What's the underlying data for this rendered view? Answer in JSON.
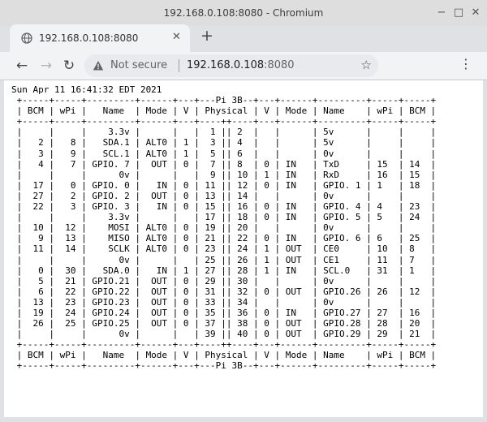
{
  "window": {
    "title": "192.168.0.108:8080 - Chromium",
    "controls": {
      "minimize": "−",
      "maximize": "□",
      "close": "✕"
    }
  },
  "tab": {
    "title": "192.168.0.108:8080",
    "favicon": "globe-icon",
    "close": "✕"
  },
  "new_tab": "+",
  "toolbar": {
    "back": "←",
    "forward": "→",
    "reload": "↻",
    "security_icon": "warning-triangle-icon",
    "not_secure": "Not secure",
    "url_host": "192.168.0.108",
    "url_port": ":8080",
    "bookmark": "☆",
    "menu": "⋮"
  },
  "page": {
    "lines": [
      "Sun Apr 11 16:41:32 EDT 2021",
      " +-----+-----+---------+------+---+---Pi 3B--+---+------+---------+-----+-----+",
      " | BCM | wPi |   Name  | Mode | V | Physical | V | Mode | Name    | wPi | BCM |",
      " +-----+-----+---------+------+---+----++----+---+------+---------+-----+-----+",
      " |     |     |    3.3v |      |   |  1 || 2  |   |      | 5v      |     |     |",
      " |   2 |   8 |   SDA.1 | ALT0 | 1 |  3 || 4  |   |      | 5v      |     |     |",
      " |   3 |   9 |   SCL.1 | ALT0 | 1 |  5 || 6  |   |      | 0v      |     |     |",
      " |   4 |   7 | GPIO. 7 |  OUT | 0 |  7 || 8  | 0 | IN   | TxD     | 15  | 14  |",
      " |     |     |      0v |      |   |  9 || 10 | 1 | IN   | RxD     | 16  | 15  |",
      " |  17 |   0 | GPIO. 0 |   IN | 0 | 11 || 12 | 0 | IN   | GPIO. 1 | 1   | 18  |",
      " |  27 |   2 | GPIO. 2 |  OUT | 0 | 13 || 14 |   |      | 0v      |     |     |",
      " |  22 |   3 | GPIO. 3 |   IN | 0 | 15 || 16 | 0 | IN   | GPIO. 4 | 4   | 23  |",
      " |     |     |    3.3v |      |   | 17 || 18 | 0 | IN   | GPIO. 5 | 5   | 24  |",
      " |  10 |  12 |    MOSI | ALT0 | 0 | 19 || 20 |   |      | 0v      |     |     |",
      " |   9 |  13 |    MISO | ALT0 | 0 | 21 || 22 | 0 | IN   | GPIO. 6 | 6   | 25  |",
      " |  11 |  14 |    SCLK | ALT0 | 0 | 23 || 24 | 1 | OUT  | CE0     | 10  | 8   |",
      " |     |     |      0v |      |   | 25 || 26 | 1 | OUT  | CE1     | 11  | 7   |",
      " |   0 |  30 |   SDA.0 |   IN | 1 | 27 || 28 | 1 | IN   | SCL.0   | 31  | 1   |",
      " |   5 |  21 | GPIO.21 |  OUT | 0 | 29 || 30 |   |      | 0v      |     |     |",
      " |   6 |  22 | GPIO.22 |  OUT | 0 | 31 || 32 | 0 | OUT  | GPIO.26 | 26  | 12  |",
      " |  13 |  23 | GPIO.23 |  OUT | 0 | 33 || 34 |   |      | 0v      |     |     |",
      " |  19 |  24 | GPIO.24 |  OUT | 0 | 35 || 36 | 0 | IN   | GPIO.27 | 27  | 16  |",
      " |  26 |  25 | GPIO.25 |  OUT | 0 | 37 || 38 | 0 | OUT  | GPIO.28 | 28  | 20  |",
      " |     |     |      0v |      |   | 39 || 40 | 0 | OUT  | GPIO.29 | 29  | 21  |",
      " +-----+-----+---------+------+---+----++----+---+------+---------+-----+-----+",
      " | BCM | wPi |   Name  | Mode | V | Physical | V | Mode | Name    | wPi | BCM |",
      " +-----+-----+---------+------+---+---Pi 3B--+---+------+---------+-----+-----+"
    ]
  }
}
